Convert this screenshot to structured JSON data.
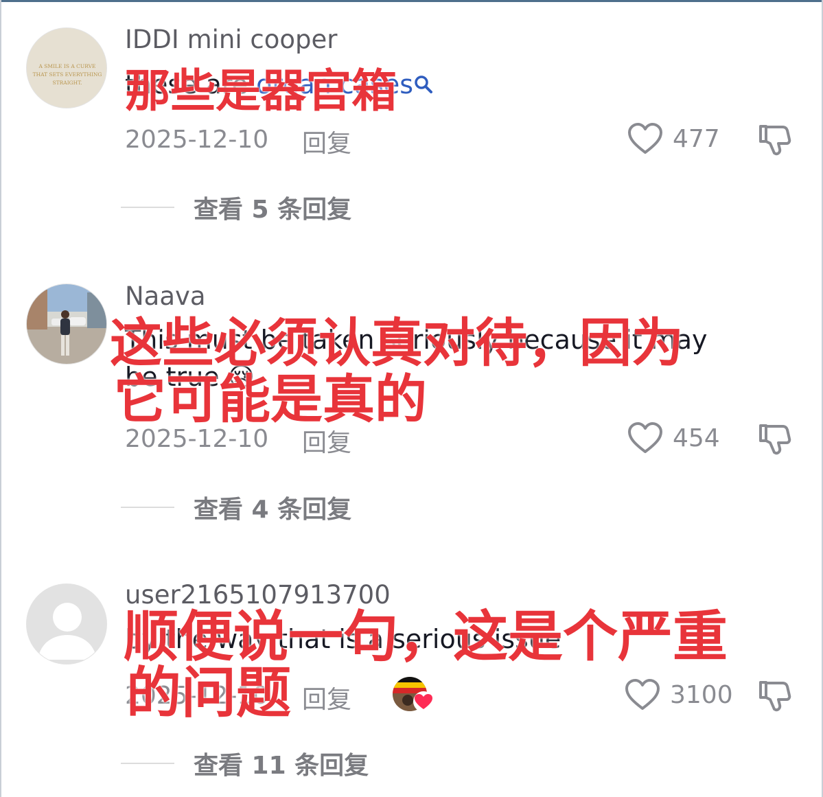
{
  "comments": [
    {
      "username": "IDDI mini cooper",
      "text_prefix": "these are ",
      "text_link": "organ cases",
      "avatar_text": "A SMILE IS A CURVE THAT SETS EVERYTHING STRAIGHT.",
      "date": "2025-12-10",
      "reply_label": "回复",
      "likes": "477",
      "view_replies": "查看 5 条回复",
      "translation": "那些是器官箱"
    },
    {
      "username": "Naava",
      "text_line1": "This must be taken seriously because it may",
      "text_line2": "be true",
      "emoji": "😢",
      "date": "2025-12-10",
      "reply_label": "回复",
      "likes": "454",
      "view_replies": "查看 4 条回复",
      "translation_line1": "这些必须认真对待，因为",
      "translation_line2": "它可能是真的"
    },
    {
      "username": "user2165107913700",
      "text": "by the way that is a serious issue",
      "date": "2025-12-10",
      "reply_label": "回复",
      "likes": "3100",
      "view_replies": "查看 11 条回复",
      "translation_line1": "顺便说一句，这是个严重",
      "translation_line2": "的问题"
    }
  ],
  "icons": {
    "like": "heart-outline-icon",
    "dislike": "thumbs-down-icon",
    "search": "search-icon",
    "liked_by_creator": "heart-badge-icon"
  },
  "colors": {
    "overlay_red": "#e8343a",
    "link_blue": "#2f5dbf",
    "meta_gray": "#8a8b91"
  }
}
